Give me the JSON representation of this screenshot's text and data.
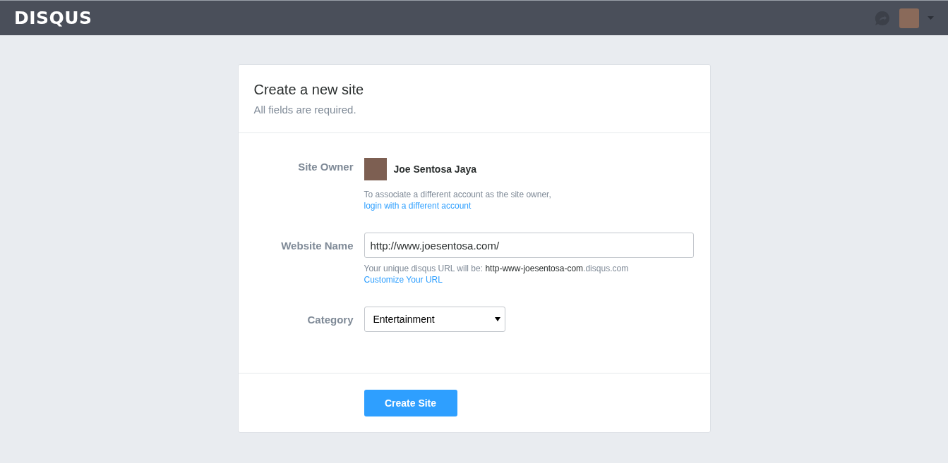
{
  "header": {
    "logo": "DISQUS"
  },
  "card": {
    "title": "Create a new site",
    "subtitle": "All fields are required."
  },
  "form": {
    "site_owner": {
      "label": "Site Owner",
      "name": "Joe Sentosa Jaya",
      "hint": "To associate a different account as the site owner,",
      "link": "login with a different account"
    },
    "website_name": {
      "label": "Website Name",
      "value": "http://www.joesentosa.com/",
      "hint_prefix": "Your unique disqus URL will be: ",
      "hint_slug": "http-www-joesentosa-com",
      "hint_suffix": ".disqus.com",
      "link": "Customize Your URL"
    },
    "category": {
      "label": "Category",
      "value": "Entertainment"
    }
  },
  "submit": "Create Site"
}
